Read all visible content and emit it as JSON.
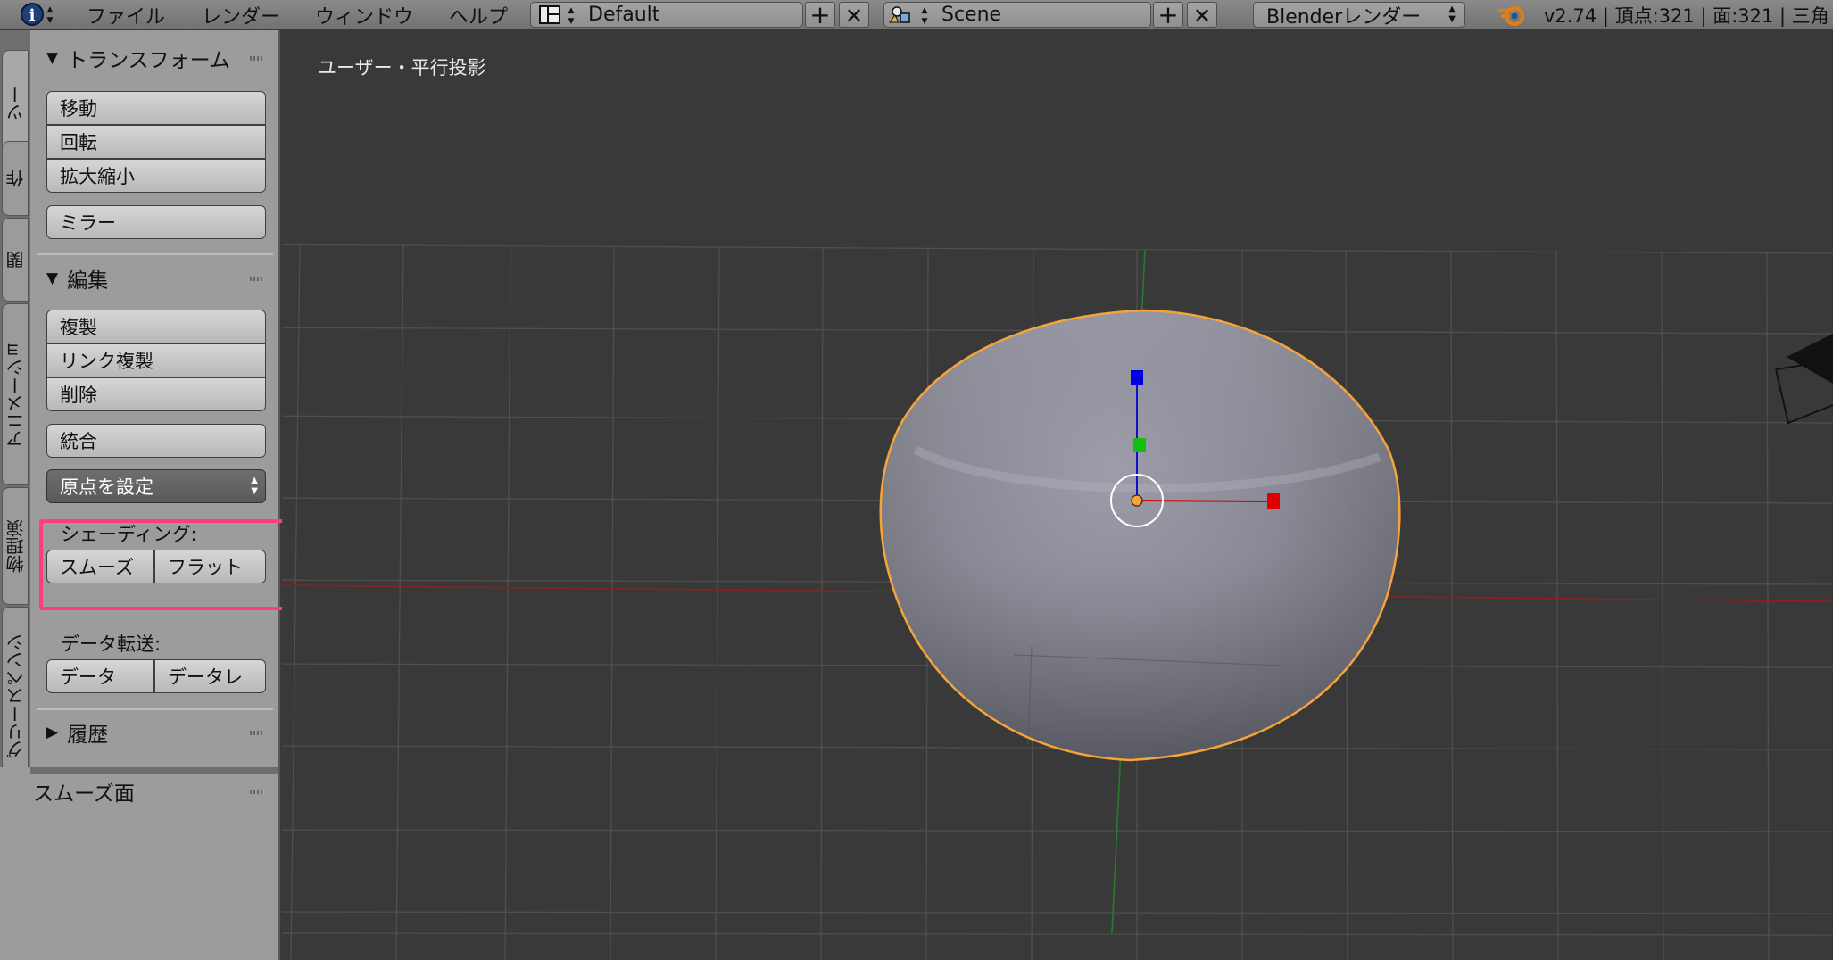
{
  "header": {
    "menus": [
      "ファイル",
      "レンダー",
      "ウィンドウ",
      "ヘルプ"
    ],
    "layout_value": "Default",
    "scene_value": "Scene",
    "render_engine": "Blenderレンダー",
    "stats": "v2.74 | 頂点:321 | 面:321 | 三角"
  },
  "tabs": [
    "ツー",
    "作",
    "関",
    "アニメーショ",
    "物理演",
    "グリースペンシ"
  ],
  "toolshelf": {
    "transform": {
      "title": "トランスフォーム",
      "move": "移動",
      "rotate": "回転",
      "scale": "拡大縮小",
      "mirror": "ミラー"
    },
    "edit": {
      "title": "編集",
      "duplicate": "複製",
      "duplicate_linked": "リンク複製",
      "delete": "削除",
      "join": "統合",
      "set_origin": "原点を設定",
      "shading_label": "シェーディング:",
      "smooth": "スムーズ",
      "flat": "フラット",
      "data_transfer_label": "データ転送:",
      "data": "データ",
      "data_layout": "データレ"
    },
    "history": {
      "title": "履歴"
    },
    "operator": {
      "title": "スムーズ面"
    }
  },
  "viewport": {
    "title": "ユーザー・平行投影"
  },
  "colors": {
    "highlight": "#ff3c80",
    "selection_outline": "#f5a33a",
    "axis_x": "#d40000",
    "axis_y": "#1ea01e",
    "axis_z": "#0000d6"
  }
}
